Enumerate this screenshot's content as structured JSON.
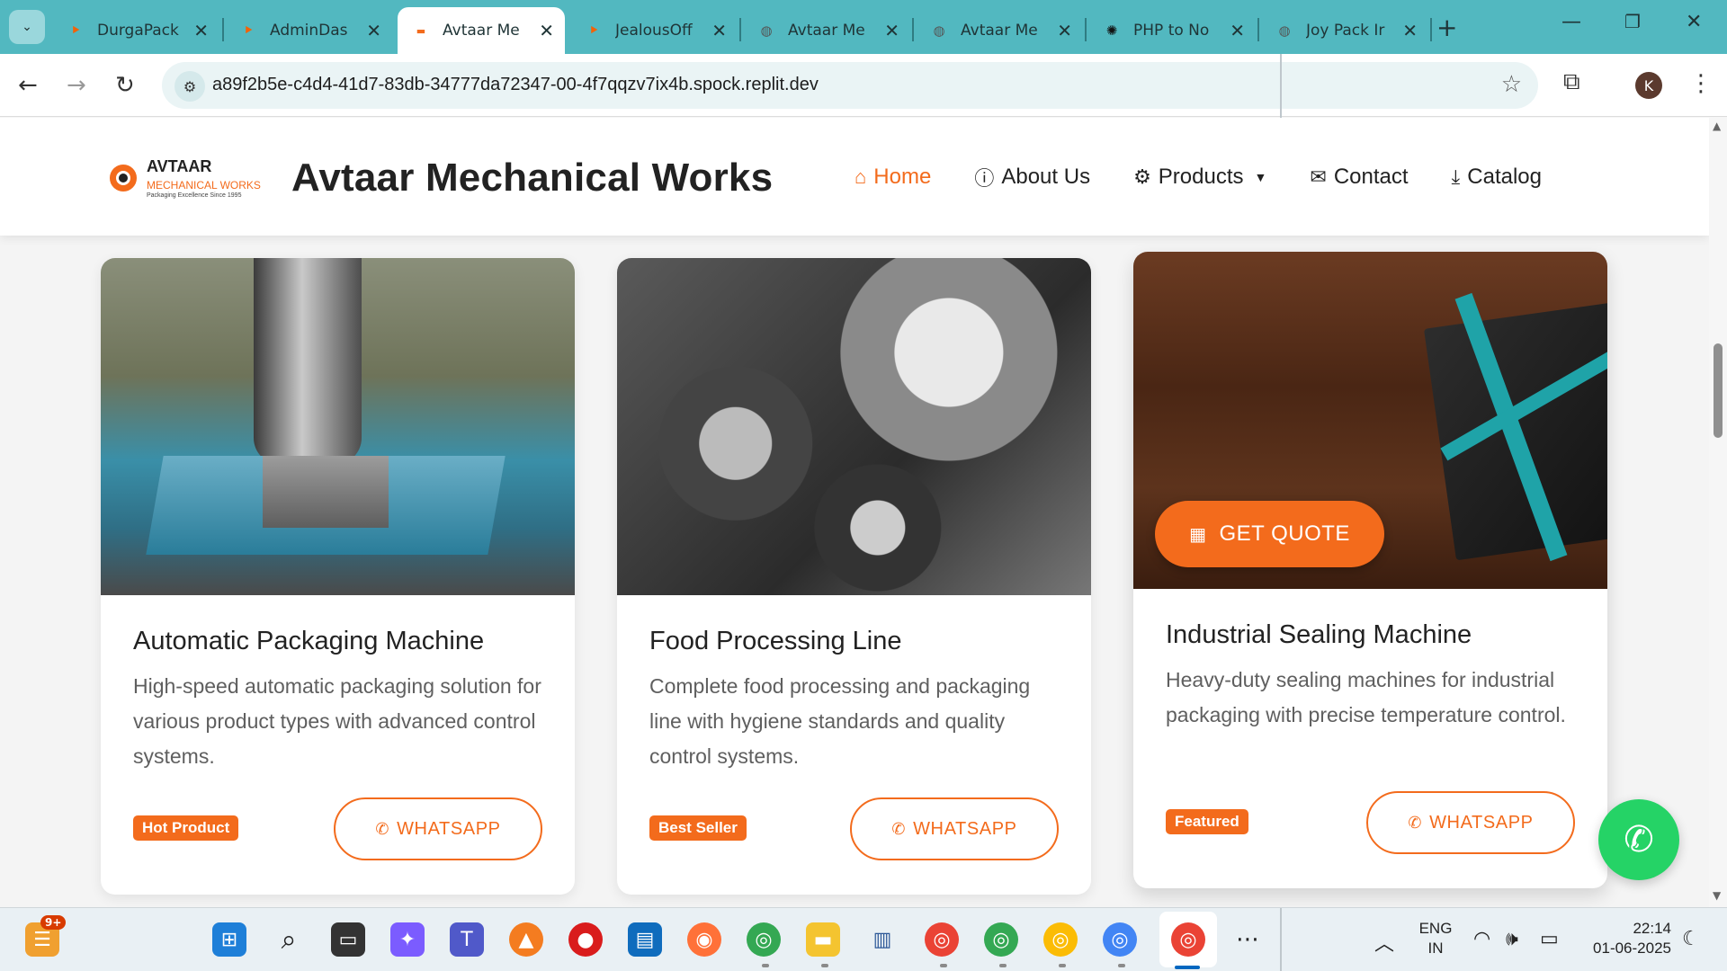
{
  "browser": {
    "tabs": [
      {
        "title": "DurgaPack",
        "icon": "replit-icon"
      },
      {
        "title": "AdminDas",
        "icon": "replit-icon"
      },
      {
        "title": "Avtaar Me",
        "icon": "site-icon",
        "active": true
      },
      {
        "title": "JealousOff",
        "icon": "replit-icon"
      },
      {
        "title": "Avtaar Me",
        "icon": "globe-icon"
      },
      {
        "title": "Avtaar Me",
        "icon": "globe-icon"
      },
      {
        "title": "PHP to No",
        "icon": "openai-icon"
      },
      {
        "title": "Joy Pack Ir",
        "icon": "globe-icon"
      }
    ],
    "url": "a89f2b5e-c4d4-41d7-83db-34777da72347-00-4f7qqzv7ix4b.spock.replit.dev",
    "profile_initial": "K",
    "accent": "#52b8c0"
  },
  "site": {
    "logo": {
      "name": "AVTAAR",
      "subtitle": "MECHANICAL WORKS",
      "tagline": "Packaging Excellence Since 1995"
    },
    "title": "Avtaar Mechanical Works",
    "brand_color": "#f36b1c",
    "nav": [
      {
        "label": "Home",
        "icon": "home-icon",
        "active": true
      },
      {
        "label": "About Us",
        "icon": "info-icon"
      },
      {
        "label": "Products",
        "icon": "cogs-icon",
        "dropdown": true
      },
      {
        "label": "Contact",
        "icon": "envelope-icon"
      },
      {
        "label": "Catalog",
        "icon": "download-icon"
      }
    ]
  },
  "products": [
    {
      "title": "Automatic Packaging Machine",
      "description": "High-speed automatic packaging solution for various product types with advanced control systems.",
      "badge": "Hot Product",
      "whatsapp_label": "WHATSAPP"
    },
    {
      "title": "Food Processing Line",
      "description": "Complete food processing and packaging line with hygiene standards and quality control systems.",
      "badge": "Best Seller",
      "whatsapp_label": "WHATSAPP"
    },
    {
      "title": "Industrial Sealing Machine",
      "description": "Heavy-duty sealing machines for industrial packaging with precise temperature control.",
      "badge": "Featured",
      "whatsapp_label": "WHATSAPP",
      "quote_label": "GET QUOTE"
    }
  ],
  "taskbar": {
    "notification_badge": "9+",
    "language": "ENG",
    "region": "IN",
    "time": "22:14",
    "date": "01-06-2025"
  }
}
